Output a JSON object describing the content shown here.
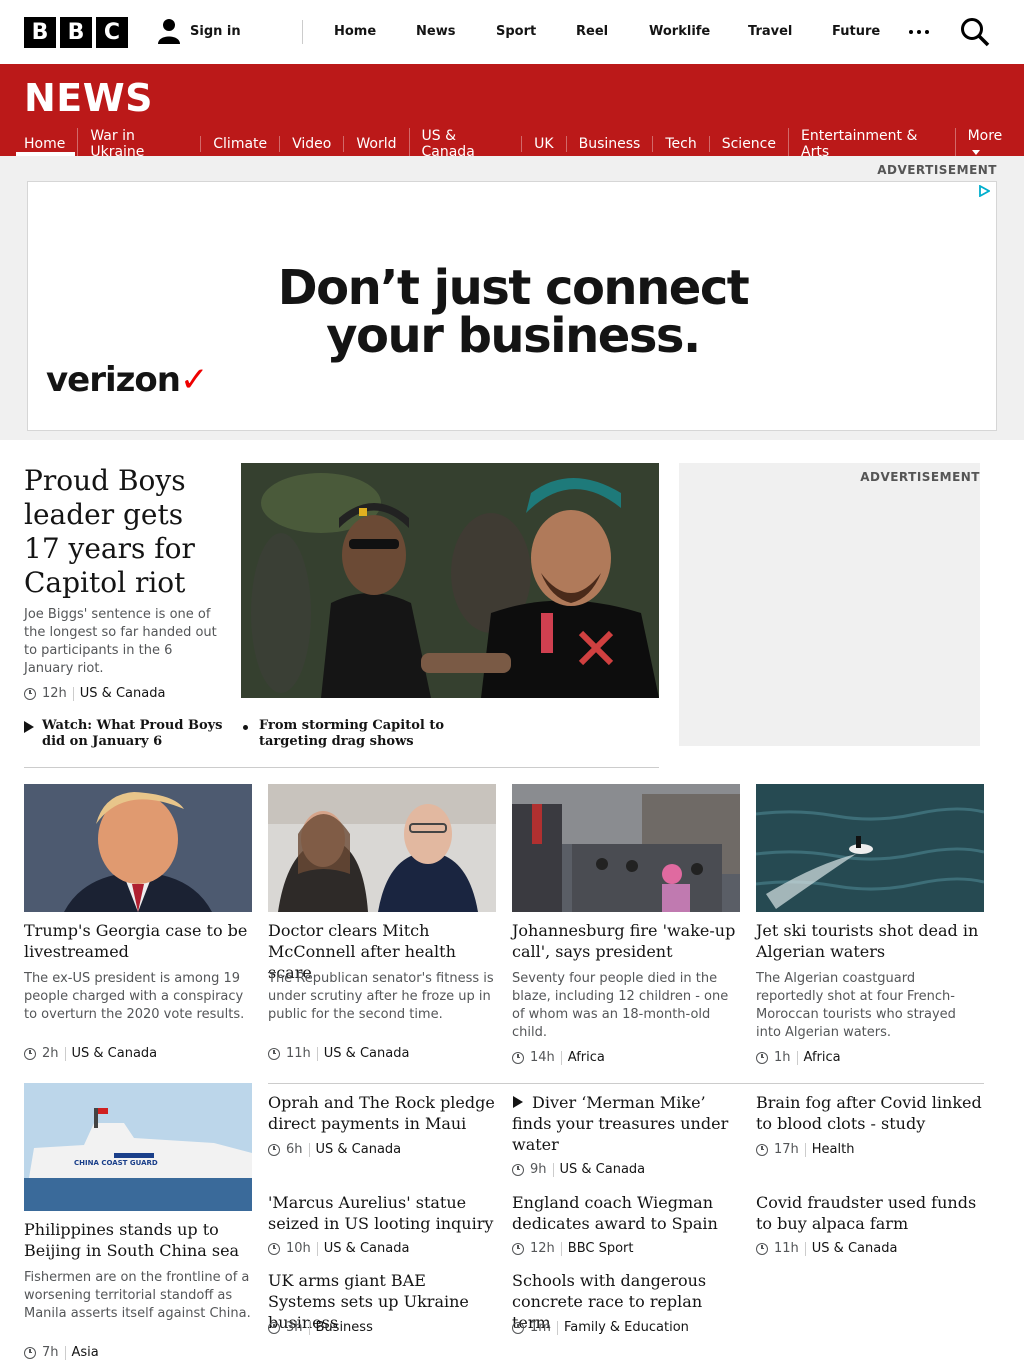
{
  "header": {
    "logo": [
      "B",
      "B",
      "C"
    ],
    "signin": "Sign in",
    "nav": [
      "Home",
      "News",
      "Sport",
      "Reel",
      "Worklife",
      "Travel",
      "Future"
    ]
  },
  "newsbar": {
    "title": "NEWS",
    "subnav": [
      "Home",
      "War in Ukraine",
      "Climate",
      "Video",
      "World",
      "US & Canada",
      "UK",
      "Business",
      "Tech",
      "Science",
      "Entertainment & Arts",
      "More"
    ]
  },
  "ads": {
    "label": "ADVERTISEMENT",
    "headline_line1": "Don’t just connect",
    "headline_line2": "your business.",
    "brand": "verizon",
    "brand_mark": "✓"
  },
  "lead": {
    "headline": "Proud Boys leader gets 17 years for Capitol riot",
    "summary": "Joe Biggs' sentence is one of the longest so far handed out to participants in the 6 January riot.",
    "time": "12h",
    "tag": "US & Canada",
    "related": [
      {
        "label": "Watch: What Proud Boys did on January 6"
      },
      {
        "label": "From storming Capitol to targeting drag shows"
      }
    ]
  },
  "row1": [
    {
      "title": "Trump's Georgia case to be livestreamed",
      "summary": "The ex-US president is among 19 people charged with a conspiracy to overturn the 2020 vote results.",
      "time": "2h",
      "tag": "US & Canada"
    },
    {
      "title": "Doctor clears Mitch McConnell after health scare",
      "summary": "The Republican senator's fitness is under scrutiny after he froze up in public for the second time.",
      "time": "11h",
      "tag": "US & Canada"
    },
    {
      "title": "Johannesburg fire 'wake-up call', says president",
      "summary": "Seventy four people died in the blaze, including 12 children - one of whom was an 18-month-old child.",
      "time": "14h",
      "tag": "Africa"
    },
    {
      "title": "Jet ski tourists shot dead in Algerian waters",
      "summary": "The Algerian coastguard reportedly shot at four French-Moroccan tourists who strayed into Algerian waters.",
      "time": "1h",
      "tag": "Africa"
    }
  ],
  "row2_feature": {
    "title": "Philippines stands up to Beijing in South China sea",
    "summary": "Fishermen are on the frontline of a worsening territorial standoff as Manila asserts itself against China.",
    "time": "7h",
    "tag": "Asia",
    "image_text": "CHINA COAST GUARD"
  },
  "row2_col2": [
    {
      "title": "Oprah and The Rock pledge direct payments in Maui",
      "time": "6h",
      "tag": "US & Canada"
    },
    {
      "title": "'Marcus Aurelius' statue seized in US looting inquiry",
      "time": "10h",
      "tag": "US & Canada"
    },
    {
      "title": "UK arms giant BAE Systems sets up Ukraine business",
      "time": "3h",
      "tag": "Business"
    }
  ],
  "row2_col3": [
    {
      "title": "Diver ‘Merman Mike’ finds your treasures under water",
      "time": "9h",
      "tag": "US & Canada"
    },
    {
      "title": "England coach Wiegman dedicates award to Spain",
      "time": "12h",
      "tag": "BBC Sport"
    },
    {
      "title": "Schools with dangerous concrete race to replan term",
      "time": "1m",
      "tag": "Family & Education"
    }
  ],
  "row2_col4": [
    {
      "title": "Brain fog after Covid linked to blood clots - study",
      "time": "17h",
      "tag": "Health"
    },
    {
      "title": "Covid fraudster used funds to buy alpaca farm",
      "time": "11h",
      "tag": "US & Canada"
    }
  ]
}
